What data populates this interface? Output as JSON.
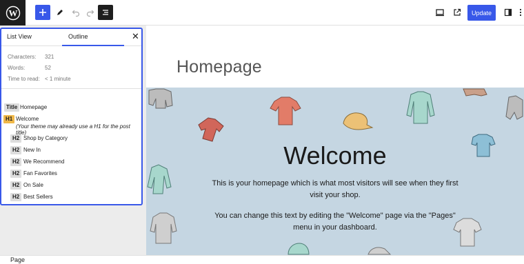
{
  "toolbar": {
    "update_label": "Update",
    "icons": [
      "wordpress-logo",
      "plus-icon",
      "pencil-icon",
      "undo-icon",
      "redo-icon",
      "document-overview-icon",
      "desktop-view-icon",
      "external-link-icon",
      "sidebar-icon",
      "more-icon"
    ]
  },
  "editor": {
    "post_title": "Homepage",
    "cover": {
      "heading": "Welcome",
      "paragraph_1": "This is your homepage which is what most visitors will see when they first visit your shop.",
      "paragraph_2": "You can change this text by editing the \"Welcome\" page via the \"Pages\" menu in your dashboard."
    }
  },
  "panel": {
    "tabs": [
      "List View",
      "Outline"
    ],
    "active_tab": "Outline",
    "stats": [
      {
        "label": "Characters:",
        "value": "321"
      },
      {
        "label": "Words:",
        "value": "52"
      },
      {
        "label": "Time to read:",
        "value": "< 1 minute"
      }
    ],
    "outline": {
      "title_badge": "Title",
      "title_text": "Homepage",
      "h1_badge": "H1",
      "h1_text": "Welcome",
      "h1_warning": "(Your theme may already use a H1 for the post title)",
      "h2_items": [
        {
          "badge": "H2",
          "text": "Shop by Category"
        },
        {
          "badge": "H2",
          "text": "New In"
        },
        {
          "badge": "H2",
          "text": "We Recommend"
        },
        {
          "badge": "H2",
          "text": "Fan Favorites"
        },
        {
          "badge": "H2",
          "text": "On Sale"
        },
        {
          "badge": "H2",
          "text": "Best Sellers"
        }
      ]
    }
  },
  "statusbar": {
    "breadcrumb": "Page"
  },
  "colors": {
    "accent": "#3858e9",
    "h1_badge": "#f0b849",
    "dark": "#1e1e1e"
  }
}
